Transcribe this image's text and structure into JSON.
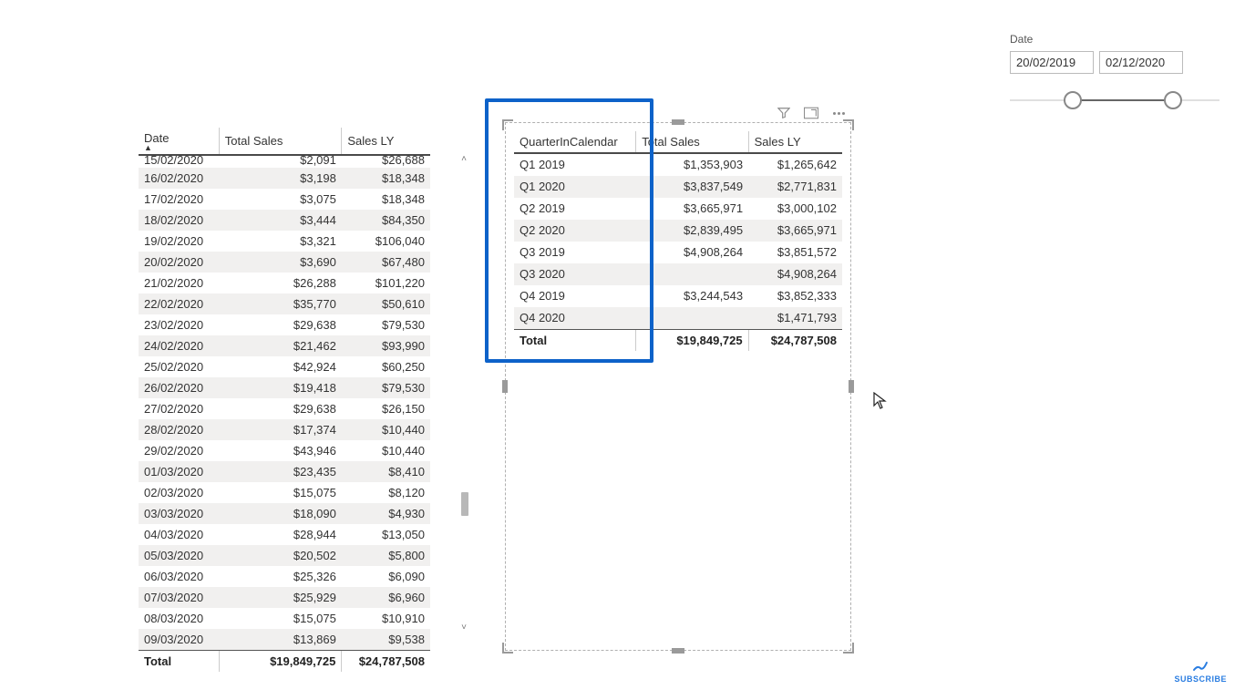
{
  "slicer": {
    "title": "Date",
    "start": "20/02/2019",
    "end": "02/12/2020",
    "thumb_left_pct": 30,
    "thumb_right_pct": 78
  },
  "left_table": {
    "headers": {
      "c1": "Date",
      "c2": "Total Sales",
      "c3": "Sales LY"
    },
    "rows": [
      {
        "date": "15/02/2020",
        "sales": "$2,091",
        "ly": "$26,688",
        "cut": true
      },
      {
        "date": "16/02/2020",
        "sales": "$3,198",
        "ly": "$18,348"
      },
      {
        "date": "17/02/2020",
        "sales": "$3,075",
        "ly": "$18,348"
      },
      {
        "date": "18/02/2020",
        "sales": "$3,444",
        "ly": "$84,350"
      },
      {
        "date": "19/02/2020",
        "sales": "$3,321",
        "ly": "$106,040"
      },
      {
        "date": "20/02/2020",
        "sales": "$3,690",
        "ly": "$67,480"
      },
      {
        "date": "21/02/2020",
        "sales": "$26,288",
        "ly": "$101,220"
      },
      {
        "date": "22/02/2020",
        "sales": "$35,770",
        "ly": "$50,610"
      },
      {
        "date": "23/02/2020",
        "sales": "$29,638",
        "ly": "$79,530"
      },
      {
        "date": "24/02/2020",
        "sales": "$21,462",
        "ly": "$93,990"
      },
      {
        "date": "25/02/2020",
        "sales": "$42,924",
        "ly": "$60,250"
      },
      {
        "date": "26/02/2020",
        "sales": "$19,418",
        "ly": "$79,530"
      },
      {
        "date": "27/02/2020",
        "sales": "$29,638",
        "ly": "$26,150"
      },
      {
        "date": "28/02/2020",
        "sales": "$17,374",
        "ly": "$10,440"
      },
      {
        "date": "29/02/2020",
        "sales": "$43,946",
        "ly": "$10,440"
      },
      {
        "date": "01/03/2020",
        "sales": "$23,435",
        "ly": "$8,410"
      },
      {
        "date": "02/03/2020",
        "sales": "$15,075",
        "ly": "$8,120"
      },
      {
        "date": "03/03/2020",
        "sales": "$18,090",
        "ly": "$4,930"
      },
      {
        "date": "04/03/2020",
        "sales": "$28,944",
        "ly": "$13,050"
      },
      {
        "date": "05/03/2020",
        "sales": "$20,502",
        "ly": "$5,800"
      },
      {
        "date": "06/03/2020",
        "sales": "$25,326",
        "ly": "$6,090"
      },
      {
        "date": "07/03/2020",
        "sales": "$25,929",
        "ly": "$6,960"
      },
      {
        "date": "08/03/2020",
        "sales": "$15,075",
        "ly": "$10,910"
      },
      {
        "date": "09/03/2020",
        "sales": "$13,869",
        "ly": "$9,538"
      }
    ],
    "total": {
      "label": "Total",
      "sales": "$19,849,725",
      "ly": "$24,787,508"
    }
  },
  "right_table": {
    "headers": {
      "c1": "QuarterInCalendar",
      "c2": "Total Sales",
      "c3": "Sales LY"
    },
    "rows": [
      {
        "q": "Q1 2019",
        "sales": "$1,353,903",
        "ly": "$1,265,642"
      },
      {
        "q": "Q1 2020",
        "sales": "$3,837,549",
        "ly": "$2,771,831"
      },
      {
        "q": "Q2 2019",
        "sales": "$3,665,971",
        "ly": "$3,000,102"
      },
      {
        "q": "Q2 2020",
        "sales": "$2,839,495",
        "ly": "$3,665,971"
      },
      {
        "q": "Q3 2019",
        "sales": "$4,908,264",
        "ly": "$3,851,572"
      },
      {
        "q": "Q3 2020",
        "sales": "",
        "ly": "$4,908,264"
      },
      {
        "q": "Q4 2019",
        "sales": "$3,244,543",
        "ly": "$3,852,333"
      },
      {
        "q": "Q4 2020",
        "sales": "",
        "ly": "$1,471,793"
      }
    ],
    "total": {
      "label": "Total",
      "sales": "$19,849,725",
      "ly": "$24,787,508"
    }
  },
  "footer": {
    "subscribe": "SUBSCRIBE"
  }
}
